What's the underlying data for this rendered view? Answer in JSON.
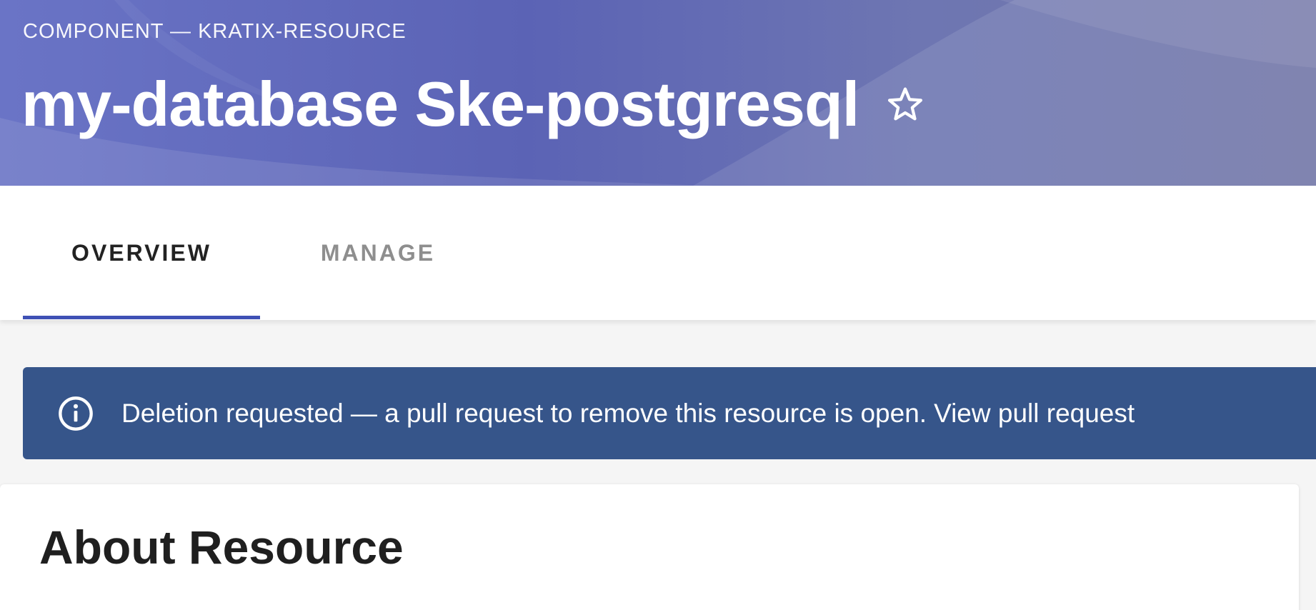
{
  "header": {
    "label": "COMPONENT — KRATIX-RESOURCE",
    "title": "my-database Ske-postgresql",
    "favorite_icon": "star-outline-icon"
  },
  "tabs": [
    {
      "label": "OVERVIEW",
      "selected": true
    },
    {
      "label": "MANAGE",
      "selected": false
    }
  ],
  "alert": {
    "icon": "info-icon",
    "message": "Deletion requested — a pull request to remove this resource is open.",
    "link_label": "View pull request"
  },
  "card": {
    "title": "About Resource"
  },
  "colors": {
    "header_gradient_start": "#6a74c6",
    "header_gradient_end": "#7277a8",
    "tab_indicator": "#3f51b5",
    "alert_background": "#36558a",
    "page_background": "#f5f5f5"
  }
}
